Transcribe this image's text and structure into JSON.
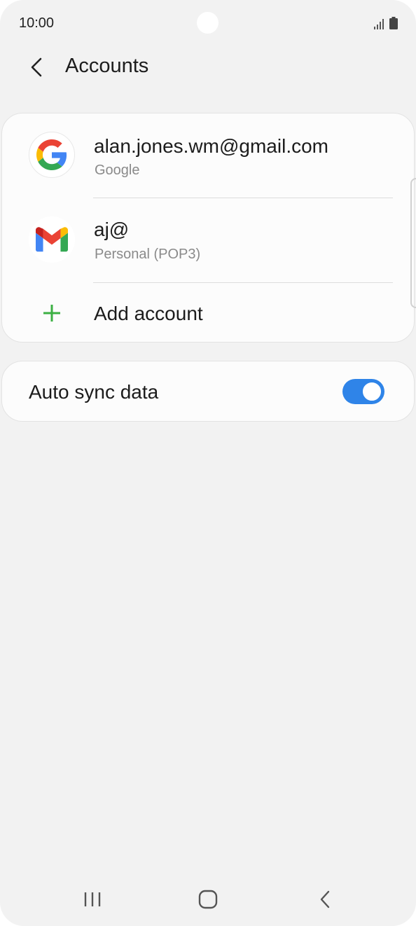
{
  "status_bar": {
    "time": "10:00"
  },
  "header": {
    "title": "Accounts"
  },
  "accounts": [
    {
      "title": "alan.jones.wm@gmail.com",
      "subtitle": "Google",
      "icon": "google-icon"
    },
    {
      "title": "aj@",
      "subtitle": "Personal (POP3)",
      "icon": "gmail-icon"
    }
  ],
  "add_account": {
    "label": "Add account",
    "icon": "plus-icon",
    "color": "#3cb043"
  },
  "auto_sync": {
    "label": "Auto sync data",
    "enabled": true,
    "color": "#2f84e8"
  },
  "nav": {
    "recents": "recents-icon",
    "home": "home-icon",
    "back": "back-icon"
  }
}
